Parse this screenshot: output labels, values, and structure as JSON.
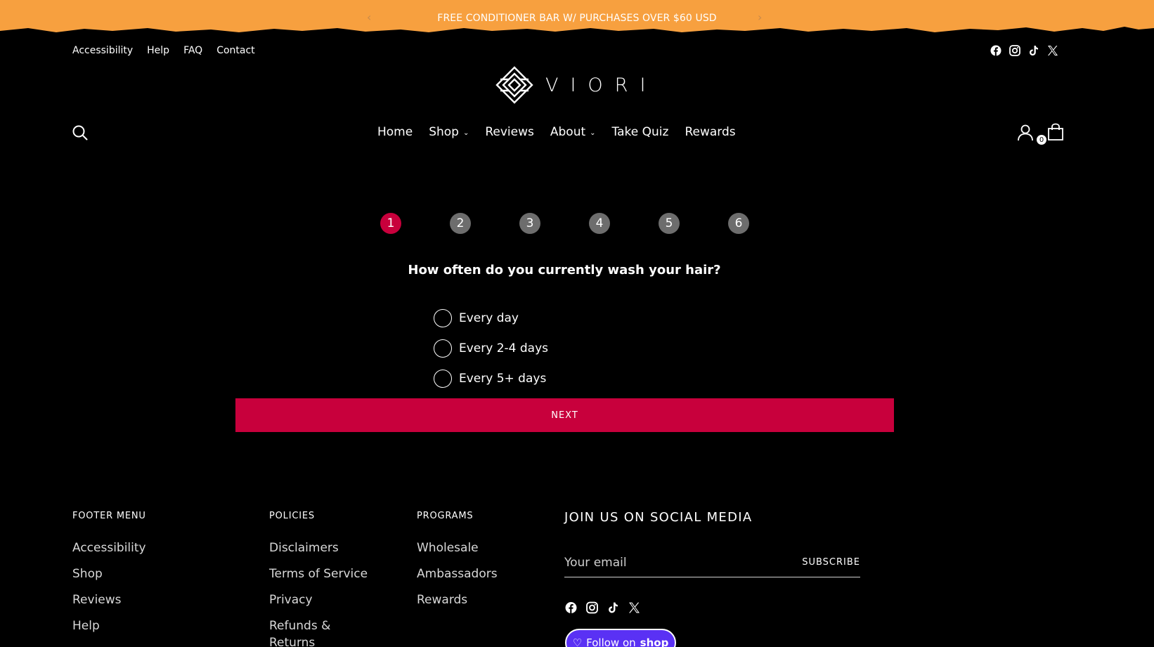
{
  "colors": {
    "announcement_bg": "#f7a03f",
    "page_bg": "#000000",
    "accent": "#c8003c",
    "step_inactive": "#6d6d6d",
    "shop_button": "#5a31f4"
  },
  "announcement": {
    "message": "FREE CONDITIONER BAR W/ PURCHASES OVER $60 USD",
    "prev_icon": "chevron-left-icon",
    "next_icon": "chevron-right-icon"
  },
  "utility_nav": [
    "Accessibility",
    "Help",
    "FAQ",
    "Contact"
  ],
  "social_top": [
    "facebook-icon",
    "instagram-icon",
    "tiktok-icon",
    "x-icon"
  ],
  "logo": {
    "text": "VIORI"
  },
  "main_nav": [
    {
      "label": "Home",
      "dropdown": false
    },
    {
      "label": "Shop",
      "dropdown": true
    },
    {
      "label": "Reviews",
      "dropdown": false
    },
    {
      "label": "About",
      "dropdown": true
    },
    {
      "label": "Take Quiz",
      "dropdown": false
    },
    {
      "label": "Rewards",
      "dropdown": false
    }
  ],
  "cart": {
    "count": "0"
  },
  "quiz": {
    "steps": [
      "1",
      "2",
      "3",
      "4",
      "5",
      "6"
    ],
    "active_step": 1,
    "question": "How often do you currently wash your hair?",
    "options": [
      "Every day",
      "Every 2-4 days",
      "Every 5+ days"
    ],
    "next_label": "NEXT"
  },
  "footer": {
    "footer_menu": {
      "heading": "FOOTER MENU",
      "links": [
        "Accessibility",
        "Shop",
        "Reviews",
        "Help"
      ]
    },
    "policies": {
      "heading": "POLICIES",
      "links": [
        "Disclaimers",
        "Terms of Service",
        "Privacy",
        "Refunds & Returns"
      ]
    },
    "programs": {
      "heading": "PROGRAMS",
      "links": [
        "Wholesale",
        "Ambassadors",
        "Rewards"
      ]
    },
    "social": {
      "heading": "JOIN US ON SOCIAL MEDIA",
      "email_placeholder": "Your email",
      "subscribe_label": "SUBSCRIBE",
      "icons": [
        "facebook-icon",
        "instagram-icon",
        "tiktok-icon",
        "x-icon"
      ],
      "shop_follow_prefix": "Follow on",
      "shop_follow_brand": "shop"
    }
  }
}
